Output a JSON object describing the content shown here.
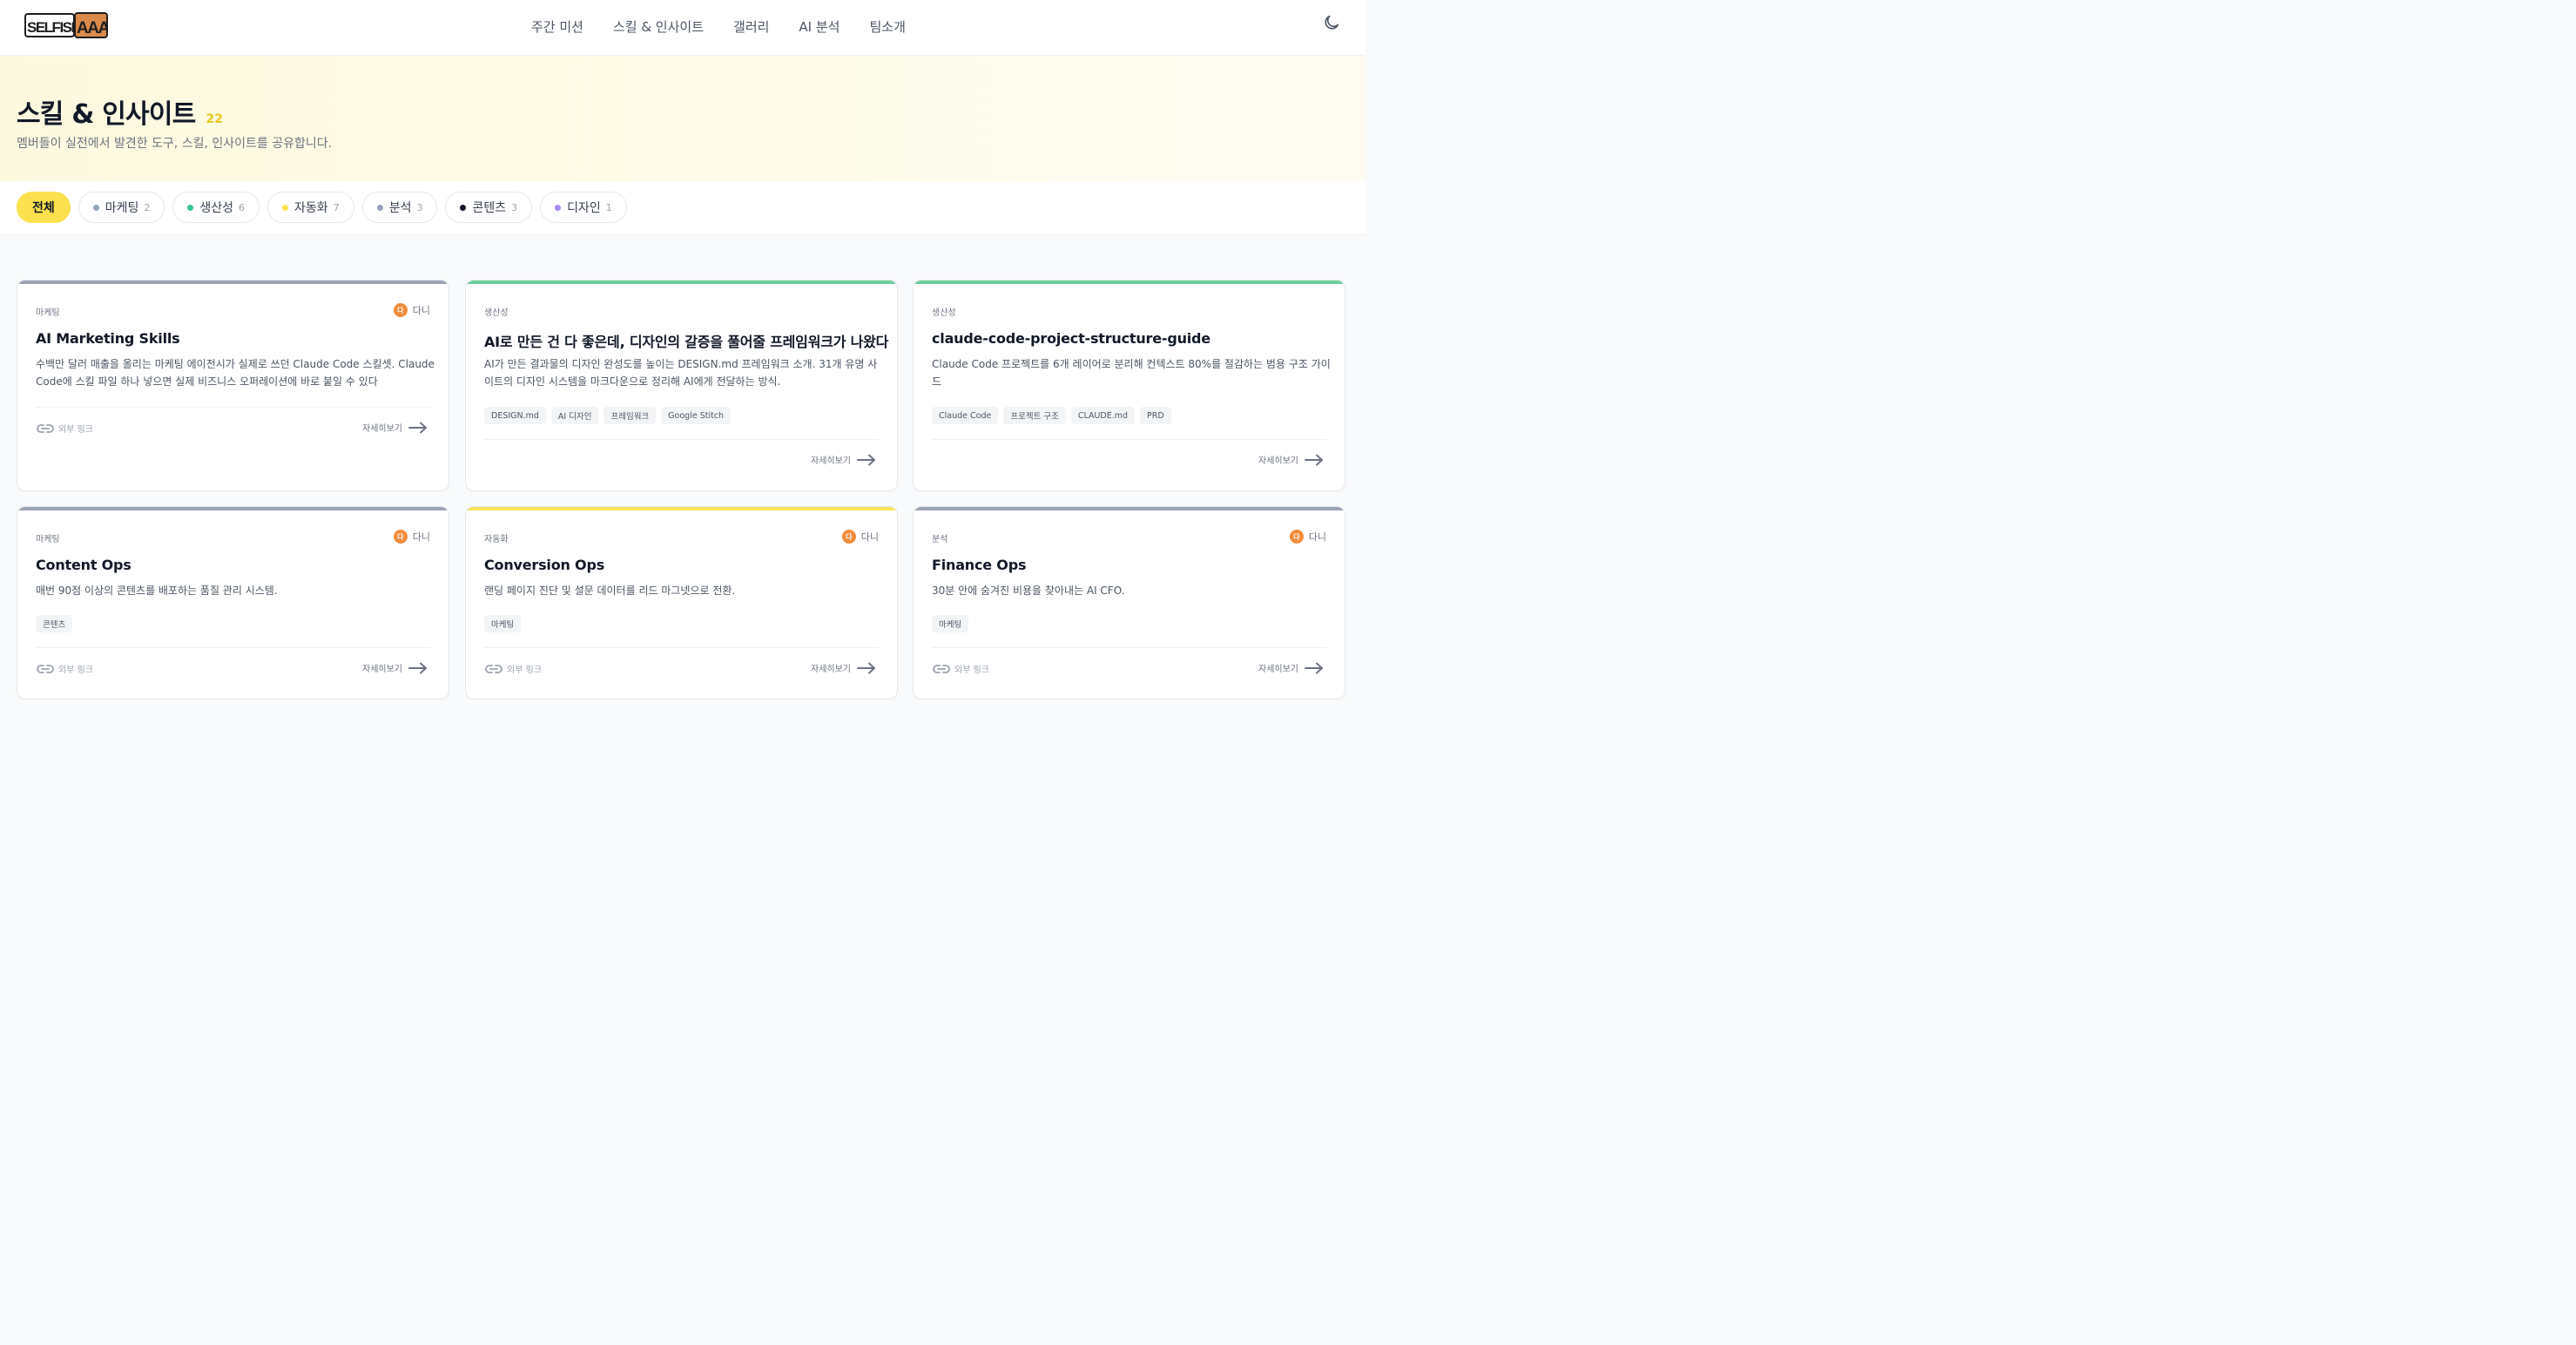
{
  "nav": {
    "logo_text": "SELFISH AAA",
    "links": [
      "주간 미션",
      "스킬 & 인사이트",
      "갤러리",
      "AI 분석",
      "팀소개"
    ],
    "theme_icon": "moon-icon"
  },
  "hero": {
    "title": "스킬 & 인사이트",
    "count": "22",
    "subtitle": "멤버들이 실전에서 발견한 도구, 스킬, 인사이트를 공유합니다."
  },
  "filters": [
    {
      "label": "전체",
      "count": "",
      "color": "",
      "active": true
    },
    {
      "label": "마케팅",
      "count": "2",
      "color": "#94a3b8",
      "active": false
    },
    {
      "label": "생산성",
      "count": "6",
      "color": "#34c38f",
      "active": false
    },
    {
      "label": "자동화",
      "count": "7",
      "color": "#fbe14d",
      "active": false
    },
    {
      "label": "분석",
      "count": "3",
      "color": "#94a3b8",
      "active": false
    },
    {
      "label": "콘텐츠",
      "count": "3",
      "color": "#111827",
      "active": false
    },
    {
      "label": "디자인",
      "count": "1",
      "color": "#a78bfa",
      "active": false
    }
  ],
  "cards": [
    {
      "category": "마케팅",
      "accent": "#9aa3b5",
      "author": "다니",
      "avatar_letter": "다",
      "title": "AI Marketing Skills",
      "description": "수백만 달러 매출을 올리는 마케팅 에이전시가 실제로 쓰던 Claude Code 스킬셋. Claude Code에 스킬 파일 하나 넣으면 실제 비즈니스 오퍼레이션에 바로 붙일 수 있다",
      "tags": [],
      "external_link": "외부 링크",
      "more": "자세히보기"
    },
    {
      "category": "생산성",
      "accent": "#6ccf9b",
      "author": "",
      "avatar_letter": "",
      "title": "AI로 만든 건 다 좋은데, 디자인의 갈증을 풀어줄 프레임워크가 나왔다",
      "description": "AI가 만든 결과물의 디자인 완성도를 높이는 DESIGN.md 프레임워크 소개. 31개 유명 사이트의 디자인 시스템을 마크다운으로 정리해 AI에게 전달하는 방식.",
      "tags": [
        "DESIGN.md",
        "AI 디자인",
        "프레임워크",
        "Google Stitch"
      ],
      "external_link": "",
      "more": "자세히보기"
    },
    {
      "category": "생산성",
      "accent": "#6ccf9b",
      "author": "",
      "avatar_letter": "",
      "title": "claude-code-project-structure-guide",
      "description": "Claude Code 프로젝트를 6개 레이어로 분리해 컨텍스트 80%를 절감하는 범용 구조 가이드",
      "tags": [
        "Claude Code",
        "프로젝트 구조",
        "CLAUDE.md",
        "PRD"
      ],
      "external_link": "",
      "more": "자세히보기"
    },
    {
      "category": "마케팅",
      "accent": "#9aa3b5",
      "author": "다니",
      "avatar_letter": "다",
      "title": "Content Ops",
      "description": "매번 90점 이상의 콘텐츠를 배포하는 품질 관리 시스템.",
      "tags": [
        "콘텐츠"
      ],
      "external_link": "외부 링크",
      "more": "자세히보기"
    },
    {
      "category": "자동화",
      "accent": "#f8e45c",
      "author": "다니",
      "avatar_letter": "다",
      "title": "Conversion Ops",
      "description": "랜딩 페이지 진단 및 설문 데이터를 리드 마그넷으로 전환.",
      "tags": [
        "마케팅"
      ],
      "external_link": "외부 링크",
      "more": "자세히보기"
    },
    {
      "category": "분석",
      "accent": "#9aa3b5",
      "author": "다니",
      "avatar_letter": "다",
      "title": "Finance Ops",
      "description": "30분 안에 숨겨진 비용을 찾아내는 AI CFO.",
      "tags": [
        "마케팅"
      ],
      "external_link": "외부 링크",
      "more": "자세히보기"
    }
  ]
}
